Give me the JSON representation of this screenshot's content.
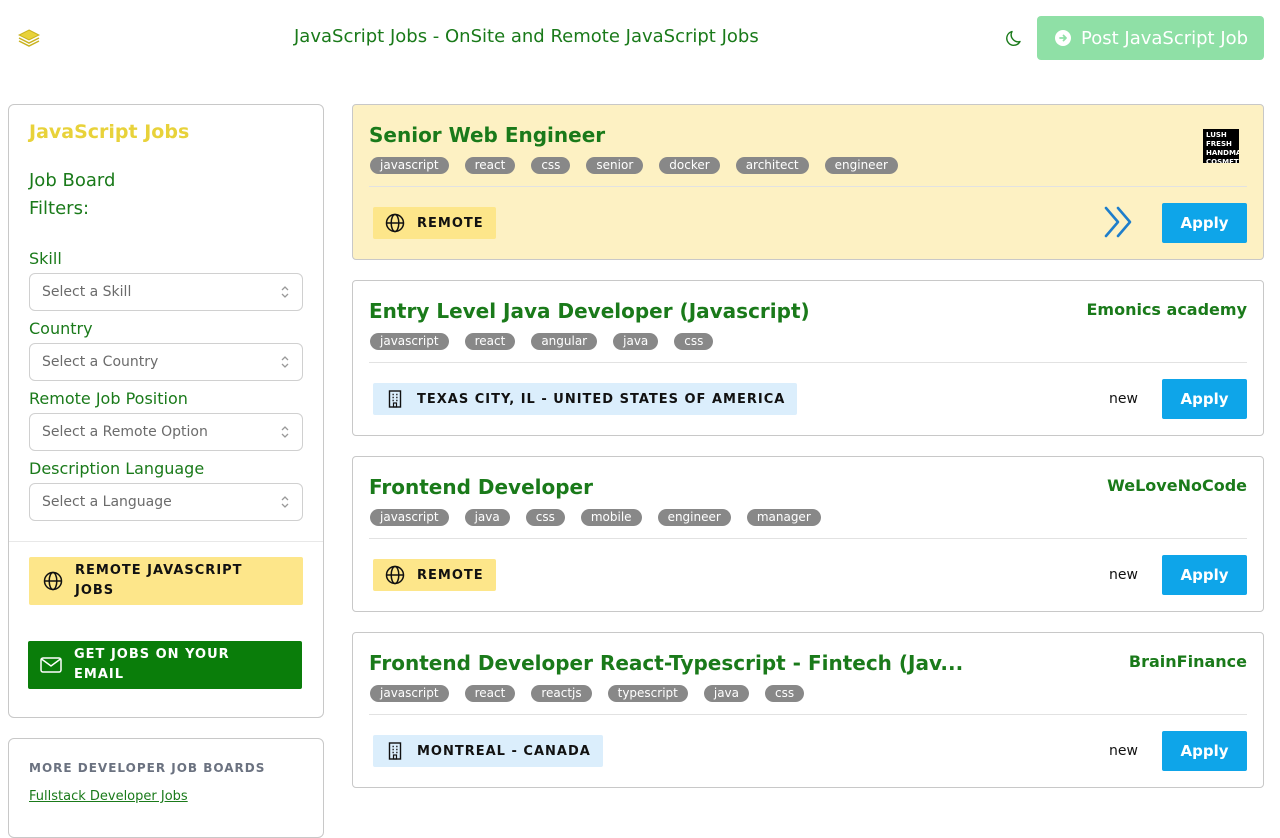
{
  "header": {
    "title": "JavaScript Jobs - OnSite and Remote JavaScript Jobs",
    "post_button": "Post JavaScript Job",
    "icons": {
      "logo": "stack-logo-icon",
      "theme_toggle": "moon-icon",
      "post": "arrow-circle-right-icon"
    }
  },
  "sidebar": {
    "title": "JavaScript Jobs",
    "subtitle": "Job Board Filters:",
    "filters": [
      {
        "label": "Skill",
        "placeholder": "Select a Skill"
      },
      {
        "label": "Country",
        "placeholder": "Select a Country"
      },
      {
        "label": "Remote Job Position",
        "placeholder": "Select a Remote Option"
      },
      {
        "label": "Description Language",
        "placeholder": "Select a Language"
      }
    ],
    "remote_button": "REMOTE JAVASCRIPT JOBS",
    "email_button": "GET JOBS ON YOUR EMAIL"
  },
  "more_boards": {
    "title": "MORE DEVELOPER JOB BOARDS",
    "first_link": "Fullstack Developer Jobs"
  },
  "jobs": [
    {
      "title": "Senior Web Engineer",
      "company_logo_text": "LUSH FRESH HANDMADE COSMETICS",
      "tags": [
        "javascript",
        "react",
        "css",
        "senior",
        "docker",
        "architect",
        "engineer"
      ],
      "location": "REMOTE",
      "location_type": "remote",
      "featured": true,
      "apply": "Apply"
    },
    {
      "title": "Entry Level Java Developer (Javascript)",
      "company": "Emonics academy",
      "tags": [
        "javascript",
        "react",
        "angular",
        "java",
        "css"
      ],
      "location": "TEXAS CITY, IL - UNITED STATES OF AMERICA",
      "location_type": "onsite",
      "status": "new",
      "apply": "Apply"
    },
    {
      "title": "Frontend Developer",
      "company": "WeLoveNoCode",
      "tags": [
        "javascript",
        "java",
        "css",
        "mobile",
        "engineer",
        "manager"
      ],
      "location": "REMOTE",
      "location_type": "remote",
      "status": "new",
      "apply": "Apply"
    },
    {
      "title": "Frontend Developer React-Typescript - Fintech (Jav...",
      "company": "BrainFinance",
      "tags": [
        "javascript",
        "react",
        "reactjs",
        "typescript",
        "java",
        "css"
      ],
      "location": "MONTREAL - CANADA",
      "location_type": "onsite",
      "status": "new",
      "apply": "Apply"
    }
  ],
  "colors": {
    "brand_green": "#1a7a1a",
    "yellow": "#fde68a",
    "apply_blue": "#0ea5e9",
    "post_button": "#8fe0a6",
    "tag_gray": "#888888"
  }
}
